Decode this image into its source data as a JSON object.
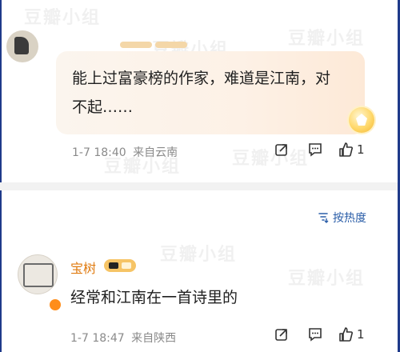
{
  "top_comment": {
    "text": "能上过富豪榜的作家，难道是江南，对不起……",
    "time": "1-7 18:40",
    "location": "来自云南",
    "likes": "1"
  },
  "sort": {
    "label": "按热度"
  },
  "reply": {
    "username": "宝树",
    "text": "经常和江南在一首诗里的",
    "time": "1-7 18:47",
    "location": "来自陕西",
    "likes": "1"
  },
  "watermark": "豆瓣小组",
  "icons": {
    "share": "share-icon",
    "comment": "comment-icon",
    "like": "thumbs-up-icon",
    "sort": "sort-icon",
    "verified": "verified-badge-icon"
  },
  "colors": {
    "username": "#e07b10",
    "sort_text": "#2b5ea8",
    "meta_text": "#8a8a8a",
    "bubble": "#fdf1e6"
  }
}
